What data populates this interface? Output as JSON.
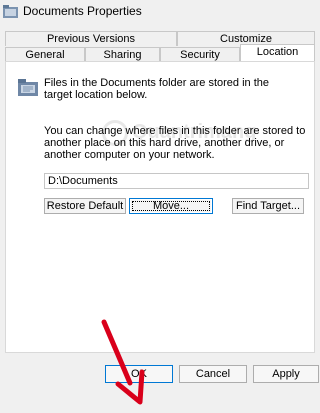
{
  "window": {
    "title": "Documents Properties"
  },
  "tabs_top": [
    "Previous Versions",
    "Customize"
  ],
  "tabs_bottom": [
    "General",
    "Sharing",
    "Security",
    "Location"
  ],
  "panel": {
    "description": "Files in the Documents folder are stored in the target location below.",
    "info": "You can change where files in this folder are stored to another place on this hard drive, another drive, or another computer on your network.",
    "path_value": "D:\\Documents"
  },
  "buttons": {
    "restore": "Restore Default",
    "move": "Move...",
    "find_target": "Find Target...",
    "ok": "OK",
    "cancel": "Cancel",
    "apply": "Apply"
  },
  "watermark": {
    "text": "Quantrimang"
  },
  "colors": {
    "accent": "#0078d4",
    "arrow": "#d9001b"
  }
}
